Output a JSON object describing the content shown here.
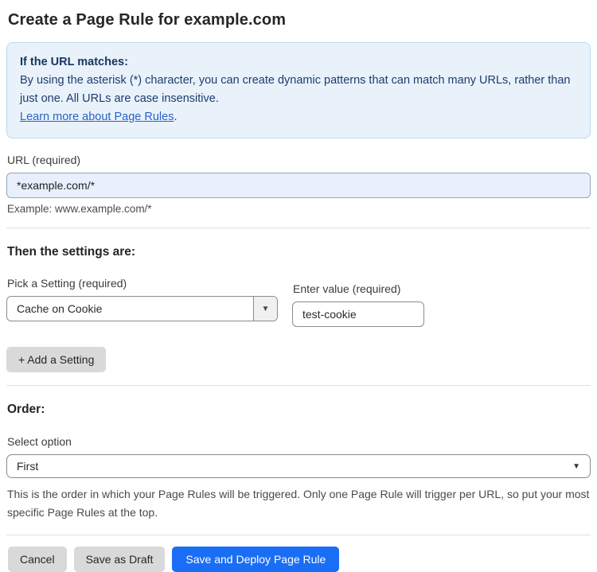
{
  "page": {
    "title": "Create a Page Rule for example.com"
  },
  "info_box": {
    "heading": "If the URL matches:",
    "body": "By using the asterisk (*) character, you can create dynamic patterns that can match many URLs, rather than just one. All URLs are case insensitive.",
    "link_label": "Learn more about Page Rules",
    "link_suffix": "."
  },
  "url_field": {
    "label": "URL (required)",
    "value": "*example.com/*",
    "hint": "Example: www.example.com/*"
  },
  "settings_section": {
    "heading": "Then the settings are:",
    "setting_select": {
      "label": "Pick a Setting (required)",
      "value": "Cache on Cookie",
      "arrow_icon": "▼"
    },
    "value_field": {
      "label": "Enter value (required)",
      "value": "test-cookie"
    },
    "add_setting_label": "+ Add a Setting"
  },
  "order_section": {
    "heading": "Order:",
    "select_label": "Select option",
    "selected_option": "First",
    "arrow_icon": "▼",
    "help_text": "This is the order in which your Page Rules will be triggered. Only one Page Rule will trigger per URL, so put your most specific Page Rules at the top."
  },
  "footer": {
    "cancel_label": "Cancel",
    "save_draft_label": "Save as Draft",
    "save_deploy_label": "Save and Deploy Page Rule"
  },
  "colors": {
    "accent_blue": "#1a6ef5",
    "info_box_bg": "#e9f2fb",
    "info_box_border": "#bcd6ee",
    "info_text": "#1d3c6d",
    "link_blue": "#2b62c8",
    "url_input_bg": "#e8f0fe",
    "gray_button_bg": "#d9d9d9"
  }
}
